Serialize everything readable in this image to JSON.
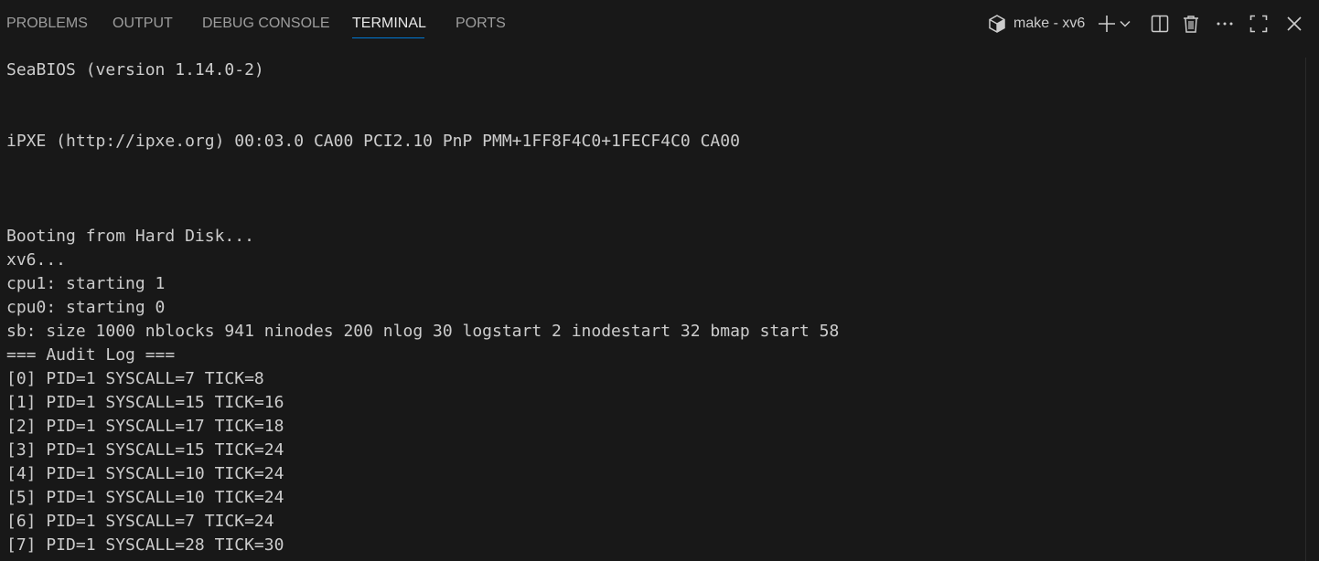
{
  "tabs": [
    {
      "label": "PROBLEMS",
      "active": false
    },
    {
      "label": "OUTPUT",
      "active": false
    },
    {
      "label": "DEBUG CONSOLE",
      "active": false
    },
    {
      "label": "TERMINAL",
      "active": true
    },
    {
      "label": "PORTS",
      "active": false
    }
  ],
  "toolbar": {
    "terminal_icon": "terminal-cube-icon",
    "terminal_name": "make - xv6",
    "icons": [
      "plus-icon",
      "chevron-down-icon",
      "split-icon",
      "trash-icon",
      "more-icon",
      "maximize-icon",
      "close-icon"
    ]
  },
  "terminal": {
    "lines": [
      "SeaBIOS (version 1.14.0-2)",
      "",
      "",
      "iPXE (http://ipxe.org) 00:03.0 CA00 PCI2.10 PnP PMM+1FF8F4C0+1FECF4C0 CA00",
      "",
      "",
      "",
      "Booting from Hard Disk...",
      "xv6...",
      "cpu1: starting 1",
      "cpu0: starting 0",
      "sb: size 1000 nblocks 941 ninodes 200 nlog 30 logstart 2 inodestart 32 bmap start 58",
      "=== Audit Log ===",
      "[0] PID=1 SYSCALL=7 TICK=8",
      "[1] PID=1 SYSCALL=15 TICK=16",
      "[2] PID=1 SYSCALL=17 TICK=18",
      "[3] PID=1 SYSCALL=15 TICK=24",
      "[4] PID=1 SYSCALL=10 TICK=24",
      "[5] PID=1 SYSCALL=10 TICK=24",
      "[6] PID=1 SYSCALL=7 TICK=24",
      "[7] PID=1 SYSCALL=28 TICK=30"
    ]
  },
  "colors": {
    "background": "#181818",
    "accent": "#0078d4",
    "text": "#cccccc"
  }
}
